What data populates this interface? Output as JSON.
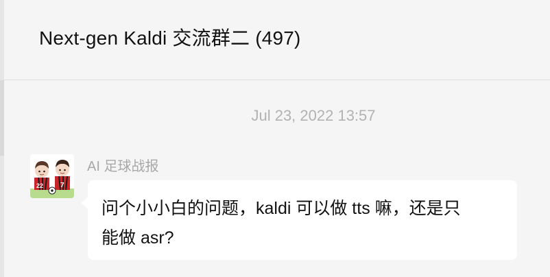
{
  "chat": {
    "title": "Next-gen Kaldi 交流群二 (497)"
  },
  "messages": [
    {
      "timestamp": "Jul 23, 2022 13:57",
      "sender": "AI 足球战报",
      "text": "问个小小白的问题，kaldi 可以做 tts 嘛，还是只\n能做 asr?"
    }
  ],
  "colors": {
    "background": "#f5f5f5",
    "bubble": "#ffffff",
    "timestamp": "#b2b2b2",
    "sender": "#a8a8a8",
    "text": "#111111"
  },
  "icons": {
    "avatar": "two-cartoon-soccer-players"
  }
}
